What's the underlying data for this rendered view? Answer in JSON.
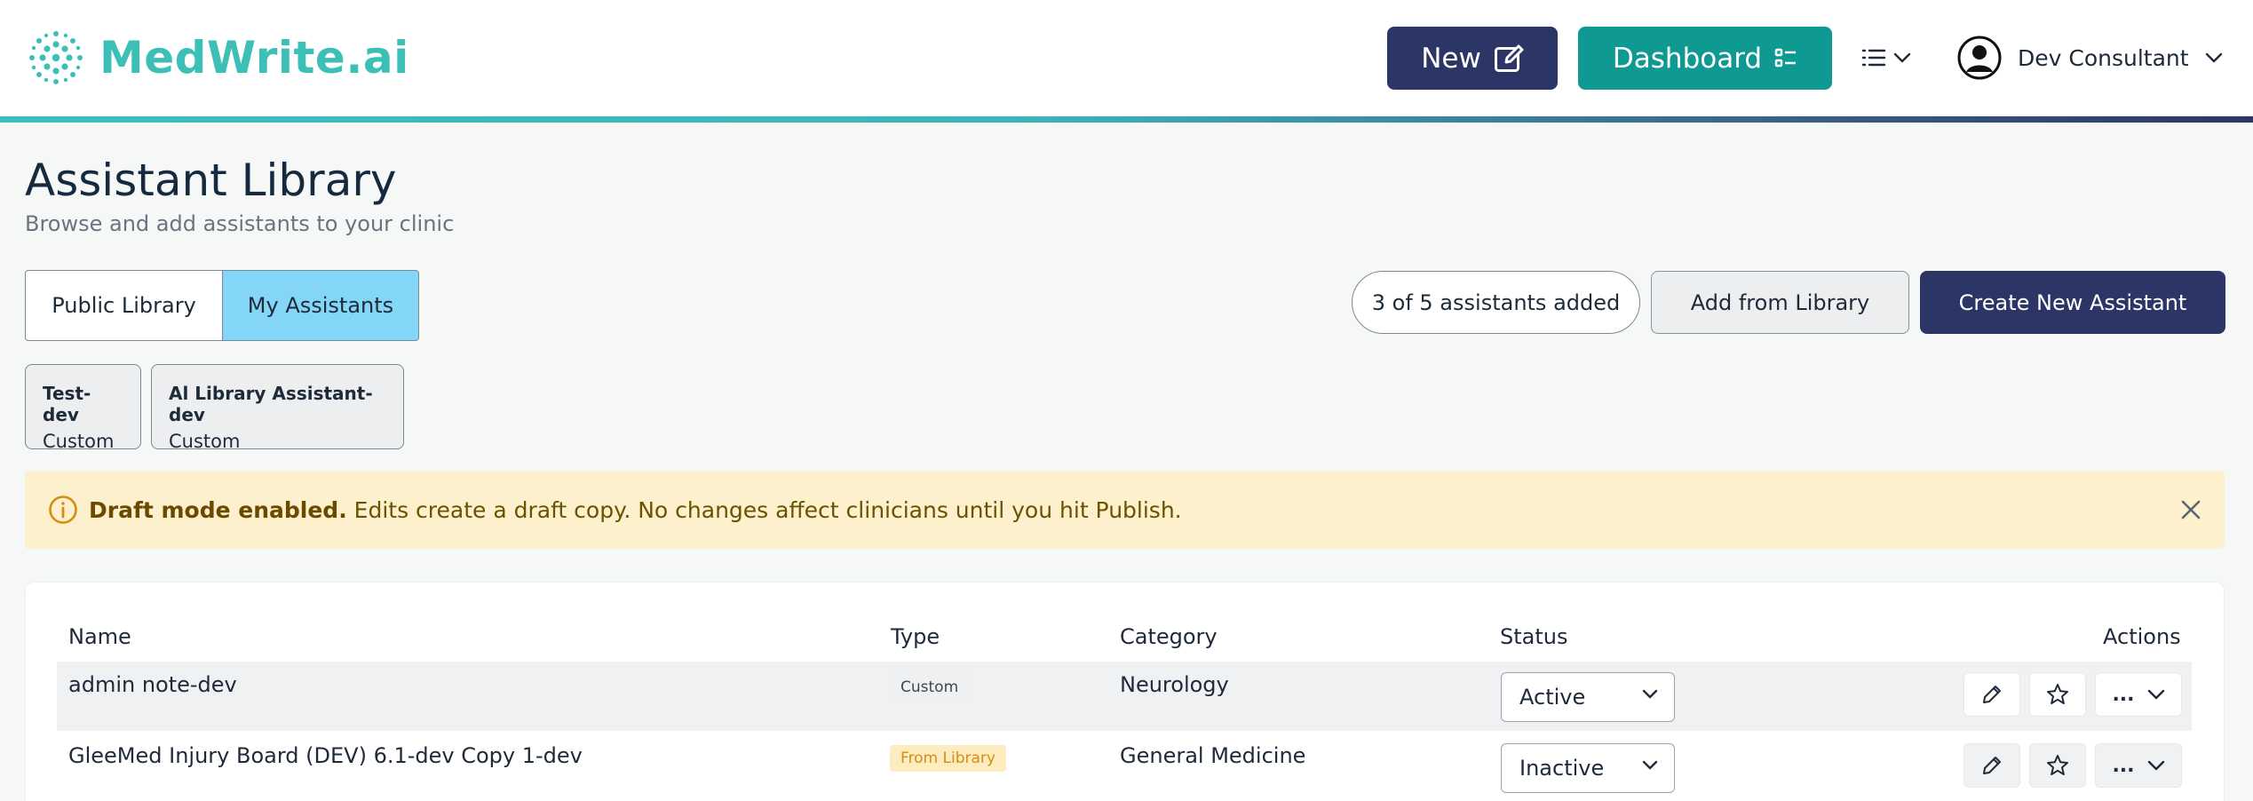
{
  "header": {
    "logo_text": "MedWrite.ai",
    "new_label": "New",
    "dashboard_label": "Dashboard",
    "user_name": "Dev Consultant"
  },
  "page": {
    "title": "Assistant Library",
    "subtitle": "Browse and add assistants to your clinic"
  },
  "tabs": [
    {
      "label": "Public Library",
      "selected": false
    },
    {
      "label": "My Assistants",
      "selected": true
    }
  ],
  "toolbar": {
    "count_text": "3 of 5 assistants added",
    "add_label": "Add from Library",
    "create_label": "Create New Assistant"
  },
  "chips": [
    {
      "name": "Test-dev",
      "type": "Custom"
    },
    {
      "name": "Al Library Assistant-dev",
      "type": "Custom"
    }
  ],
  "banner": {
    "bold": "Draft mode enabled.",
    "text": " Edits create a draft copy. No changes affect clinicians until you hit Publish."
  },
  "table": {
    "headers": {
      "name": "Name",
      "type": "Type",
      "category": "Category",
      "status": "Status",
      "actions": "Actions"
    },
    "rows": [
      {
        "name": "admin note-dev",
        "type": "Custom",
        "category": "Neurology",
        "status": "Active"
      },
      {
        "name": "GleeMed Injury Board (DEV) 6.1-dev Copy 1-dev",
        "type": "From Library",
        "category": "General Medicine",
        "status": "Inactive"
      }
    ],
    "more_label": "..."
  },
  "colors": {
    "brand_teal": "#3cbfb6",
    "navy": "#2b3566",
    "dashboard_teal": "#0e9a93",
    "tab_selected": "#84d6f6",
    "banner_bg": "#fdf0cc",
    "library_badge": "#d68c12"
  }
}
